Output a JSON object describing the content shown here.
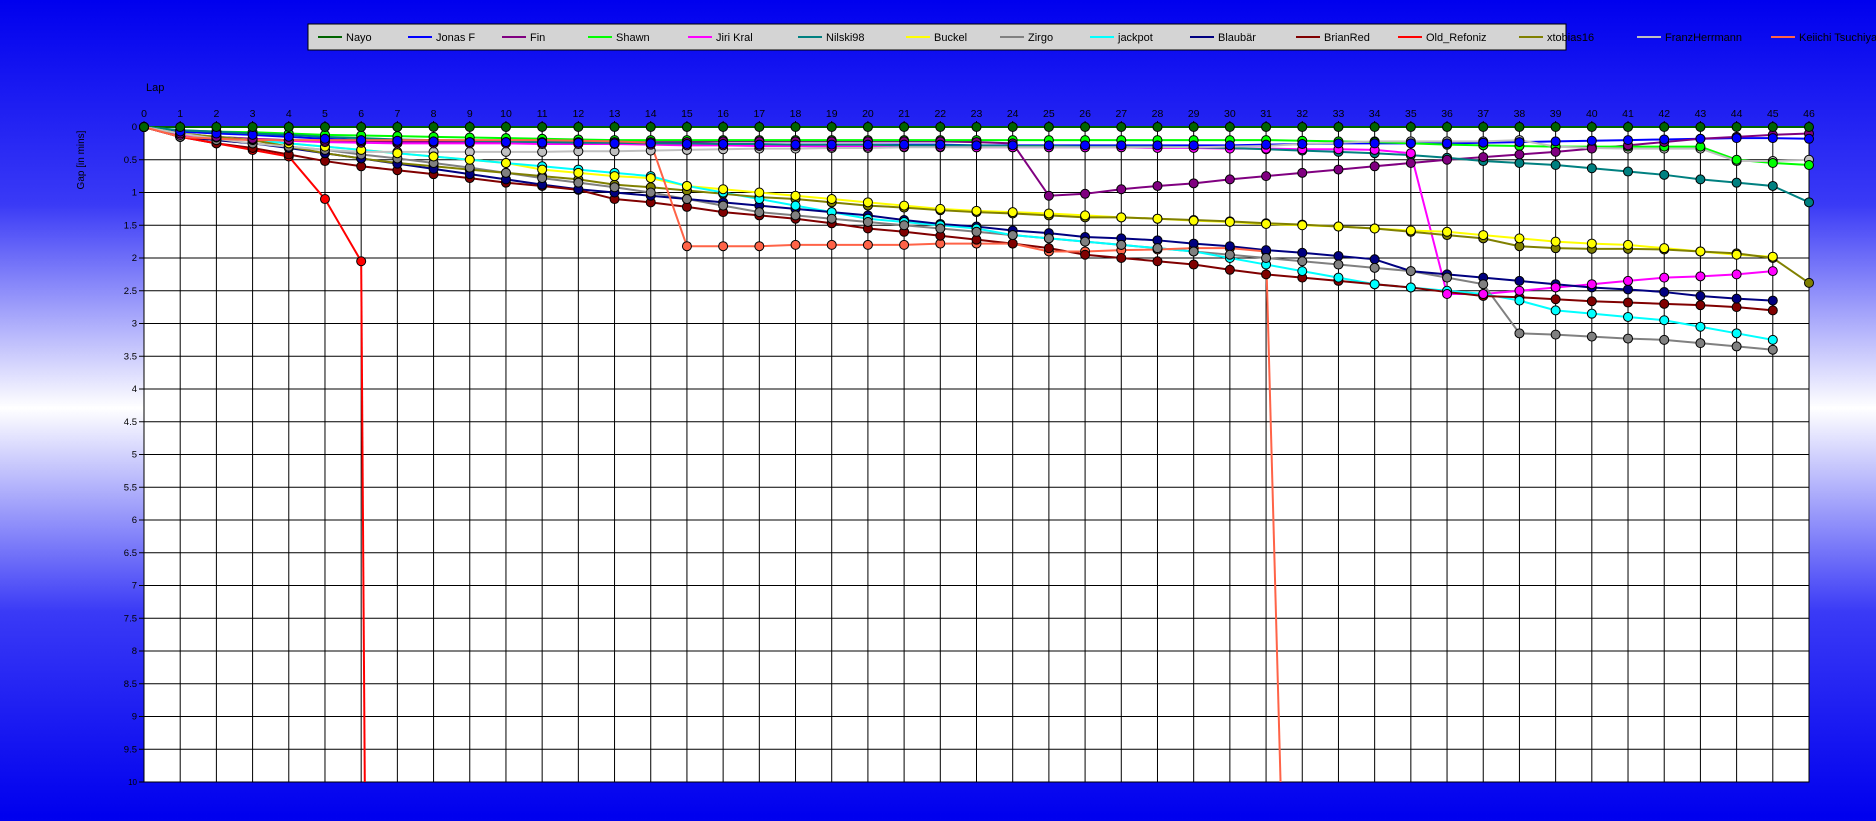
{
  "chart_data": {
    "type": "line",
    "xlabel": "Lap",
    "ylabel": "Gap [in mins]",
    "x": [
      0,
      1,
      2,
      3,
      4,
      5,
      6,
      7,
      8,
      9,
      10,
      11,
      12,
      13,
      14,
      15,
      16,
      17,
      18,
      19,
      20,
      21,
      22,
      23,
      24,
      25,
      26,
      27,
      28,
      29,
      30,
      31,
      32,
      33,
      34,
      35,
      36,
      37,
      38,
      39,
      40,
      41,
      42,
      43,
      44,
      45,
      46
    ],
    "xlim": [
      0,
      46
    ],
    "ylim": [
      0,
      10
    ],
    "y_inverted": true,
    "ytick_step": 0.5,
    "grid": true,
    "legend_position": "top-center",
    "series": [
      {
        "name": "Nayo",
        "color": "#006400",
        "values": [
          0,
          0,
          0,
          0,
          0,
          0,
          0,
          0,
          0,
          0,
          0,
          0,
          0,
          0,
          0,
          0,
          0,
          0,
          0,
          0,
          0,
          0,
          0,
          0,
          0,
          0,
          0,
          0,
          0,
          0,
          0,
          0,
          0,
          0,
          0,
          0,
          0,
          0,
          0,
          0,
          0,
          0,
          0,
          0,
          0,
          0,
          0
        ]
      },
      {
        "name": "Jonas F",
        "color": "#0000ff",
        "values": [
          0,
          0.07,
          0.1,
          0.12,
          0.15,
          0.18,
          0.2,
          0.21,
          0.22,
          0.23,
          0.23,
          0.24,
          0.24,
          0.25,
          0.25,
          0.26,
          0.26,
          0.27,
          0.27,
          0.27,
          0.27,
          0.27,
          0.27,
          0.28,
          0.28,
          0.28,
          0.28,
          0.28,
          0.28,
          0.28,
          0.28,
          0.27,
          0.26,
          0.25,
          0.25,
          0.25,
          0.25,
          0.24,
          0.23,
          0.22,
          0.21,
          0.2,
          0.19,
          0.18,
          0.17,
          0.17,
          0.18
        ]
      },
      {
        "name": "Fin",
        "color": "#800080",
        "values": [
          0,
          0.1,
          0.15,
          0.18,
          0.2,
          0.21,
          0.22,
          0.23,
          0.23,
          0.23,
          0.23,
          0.23,
          0.23,
          0.23,
          0.23,
          0.23,
          0.22,
          0.22,
          0.22,
          0.22,
          0.22,
          0.22,
          0.22,
          0.23,
          0.25,
          1.05,
          1.02,
          0.95,
          0.9,
          0.86,
          0.8,
          0.75,
          0.7,
          0.65,
          0.6,
          0.55,
          0.5,
          0.46,
          0.42,
          0.38,
          0.33,
          0.28,
          0.23,
          0.18,
          0.15,
          0.12,
          0.1
        ]
      },
      {
        "name": "Shawn",
        "color": "#00ff00",
        "values": [
          0,
          0.05,
          0.07,
          0.08,
          0.1,
          0.12,
          0.13,
          0.14,
          0.15,
          0.16,
          0.17,
          0.18,
          0.19,
          0.2,
          0.2,
          0.2,
          0.2,
          0.2,
          0.2,
          0.2,
          0.2,
          0.2,
          0.2,
          0.2,
          0.2,
          0.2,
          0.2,
          0.2,
          0.2,
          0.2,
          0.2,
          0.2,
          0.21,
          0.22,
          0.23,
          0.25,
          0.27,
          0.28,
          0.29,
          0.3,
          0.3,
          0.3,
          0.3,
          0.3,
          0.5,
          0.55,
          0.58
        ]
      },
      {
        "name": "Jiri Kral",
        "color": "#ff00ff",
        "values": [
          0,
          0.12,
          0.16,
          0.19,
          0.21,
          0.23,
          0.24,
          0.25,
          0.25,
          0.25,
          0.25,
          0.26,
          0.26,
          0.26,
          0.27,
          0.28,
          0.28,
          0.29,
          0.29,
          0.3,
          0.3,
          0.3,
          0.3,
          0.31,
          0.31,
          0.31,
          0.31,
          0.31,
          0.32,
          0.32,
          0.33,
          0.33,
          0.34,
          0.34,
          0.35,
          0.4,
          2.55,
          2.55,
          2.5,
          2.45,
          2.4,
          2.35,
          2.3,
          2.28,
          2.25,
          2.2,
          null
        ]
      },
      {
        "name": "Nilski98",
        "color": "#008080",
        "values": [
          0,
          0.05,
          0.07,
          0.1,
          0.12,
          0.15,
          0.17,
          0.19,
          0.2,
          0.21,
          0.22,
          0.23,
          0.24,
          0.24,
          0.25,
          0.25,
          0.26,
          0.26,
          0.27,
          0.27,
          0.27,
          0.28,
          0.28,
          0.28,
          0.29,
          0.29,
          0.3,
          0.3,
          0.3,
          0.31,
          0.32,
          0.34,
          0.36,
          0.38,
          0.4,
          0.43,
          0.47,
          0.52,
          0.55,
          0.58,
          0.63,
          0.68,
          0.73,
          0.8,
          0.85,
          0.9,
          1.15
        ]
      },
      {
        "name": "Buckel",
        "color": "#ffff00",
        "values": [
          0,
          0.1,
          0.15,
          0.2,
          0.25,
          0.3,
          0.35,
          0.4,
          0.45,
          0.5,
          0.55,
          0.65,
          0.7,
          0.75,
          0.78,
          0.9,
          0.95,
          1.0,
          1.05,
          1.1,
          1.15,
          1.2,
          1.25,
          1.28,
          1.3,
          1.32,
          1.35,
          1.38,
          1.4,
          1.43,
          1.45,
          1.48,
          1.5,
          1.52,
          1.55,
          1.58,
          1.6,
          1.65,
          1.7,
          1.75,
          1.78,
          1.8,
          1.85,
          1.9,
          1.95,
          1.98,
          null
        ]
      },
      {
        "name": "Zirgo",
        "color": "#808080",
        "values": [
          0,
          0.15,
          0.2,
          0.25,
          0.3,
          0.35,
          0.42,
          0.48,
          0.55,
          0.62,
          0.7,
          0.78,
          0.85,
          0.92,
          1.0,
          1.1,
          1.2,
          1.3,
          1.35,
          1.4,
          1.45,
          1.5,
          1.55,
          1.6,
          1.65,
          1.7,
          1.75,
          1.8,
          1.85,
          1.9,
          1.95,
          2.0,
          2.05,
          2.1,
          2.15,
          2.2,
          2.3,
          2.4,
          3.15,
          3.17,
          3.2,
          3.23,
          3.25,
          3.3,
          3.35,
          3.4,
          null
        ]
      },
      {
        "name": "jackpot",
        "color": "#00ffff",
        "values": [
          0,
          0.1,
          0.15,
          0.2,
          0.25,
          0.3,
          0.35,
          0.4,
          0.45,
          0.5,
          0.55,
          0.6,
          0.65,
          0.7,
          0.75,
          0.9,
          1.0,
          1.1,
          1.2,
          1.3,
          1.4,
          1.45,
          1.5,
          1.55,
          1.65,
          1.7,
          1.75,
          1.8,
          1.85,
          1.9,
          2.0,
          2.1,
          2.2,
          2.3,
          2.4,
          2.45,
          2.5,
          2.55,
          2.65,
          2.8,
          2.85,
          2.9,
          2.95,
          3.05,
          3.15,
          3.25,
          null
        ]
      },
      {
        "name": "Blaubär",
        "color": "#000080",
        "values": [
          0,
          0.15,
          0.2,
          0.25,
          0.32,
          0.4,
          0.48,
          0.56,
          0.64,
          0.72,
          0.8,
          0.88,
          0.95,
          1.0,
          1.05,
          1.1,
          1.15,
          1.2,
          1.25,
          1.3,
          1.35,
          1.42,
          1.48,
          1.52,
          1.58,
          1.62,
          1.68,
          1.7,
          1.73,
          1.78,
          1.82,
          1.88,
          1.92,
          1.97,
          2.02,
          2.2,
          2.25,
          2.3,
          2.35,
          2.4,
          2.45,
          2.48,
          2.52,
          2.58,
          2.62,
          2.65,
          null
        ]
      },
      {
        "name": "BrianRed",
        "color": "#800000",
        "values": [
          0,
          0.15,
          0.25,
          0.32,
          0.42,
          0.52,
          0.6,
          0.66,
          0.72,
          0.78,
          0.85,
          0.9,
          0.96,
          1.1,
          1.15,
          1.22,
          1.3,
          1.35,
          1.4,
          1.47,
          1.55,
          1.6,
          1.66,
          1.72,
          1.78,
          1.85,
          1.95,
          2.0,
          2.05,
          2.1,
          2.18,
          2.25,
          2.3,
          2.35,
          2.4,
          2.45,
          2.52,
          2.58,
          2.6,
          2.63,
          2.66,
          2.68,
          2.7,
          2.72,
          2.75,
          2.8,
          null
        ]
      },
      {
        "name": "Old_Refoniz",
        "color": "#ff0000",
        "values": [
          0,
          0.15,
          0.25,
          0.35,
          0.45,
          1.1,
          2.05,
          null,
          null,
          null,
          null,
          null,
          null,
          null,
          null,
          null,
          null,
          null,
          null,
          null,
          null,
          null,
          null,
          null,
          null,
          null,
          null,
          null,
          null,
          null,
          null,
          null,
          null,
          null,
          null,
          null,
          null,
          null,
          null,
          null,
          null,
          null,
          null,
          null,
          null,
          null,
          null
        ]
      },
      {
        "name": "xtobias16",
        "color": "#808000",
        "values": [
          0,
          0.1,
          0.15,
          0.2,
          0.3,
          0.4,
          0.48,
          0.55,
          0.6,
          0.65,
          0.7,
          0.75,
          0.8,
          0.88,
          0.92,
          0.97,
          1.02,
          1.07,
          1.1,
          1.15,
          1.2,
          1.23,
          1.27,
          1.3,
          1.32,
          1.35,
          1.38,
          1.38,
          1.4,
          1.42,
          1.44,
          1.47,
          1.49,
          1.52,
          1.55,
          1.6,
          1.65,
          1.7,
          1.82,
          1.85,
          1.86,
          1.86,
          1.87,
          1.9,
          1.93,
          2.0,
          2.38
        ]
      },
      {
        "name": "FranzHerrmann",
        "color": "#c0c0c0",
        "values": [
          0,
          0.1,
          0.18,
          0.25,
          0.3,
          0.35,
          0.38,
          0.38,
          0.38,
          0.38,
          0.38,
          0.38,
          0.37,
          0.37,
          0.36,
          0.35,
          0.34,
          0.33,
          0.33,
          0.32,
          0.32,
          0.31,
          0.31,
          0.31,
          0.31,
          0.31,
          0.31,
          0.31,
          0.31,
          0.31,
          0.3,
          0.29,
          0.26,
          0.24,
          0.22,
          0.22,
          0.22,
          0.22,
          0.2,
          0.3,
          0.32,
          0.33,
          0.33,
          0.33,
          0.52,
          0.52,
          0.5
        ]
      },
      {
        "name": "Keiichi Tsuchiya",
        "color": "#ff6347",
        "values": [
          0,
          0.15,
          0.18,
          0.2,
          0.2,
          0.2,
          0.2,
          0.2,
          0.2,
          0.2,
          0.2,
          0.2,
          0.21,
          0.22,
          0.24,
          1.82,
          1.82,
          1.82,
          1.8,
          1.8,
          1.8,
          1.8,
          1.78,
          1.78,
          1.78,
          1.9,
          1.9,
          1.88,
          1.87,
          1.85,
          1.85,
          1.9,
          null,
          null,
          null,
          null,
          null,
          null,
          null,
          null,
          null,
          null,
          null,
          null,
          null,
          null,
          null
        ]
      }
    ],
    "retired": [
      {
        "name": "Old_Refoniz",
        "last_x": 6,
        "to_x": 6.1
      },
      {
        "name": "Keiichi Tsuchiya",
        "last_x": 31,
        "to_x": 31.4
      }
    ]
  }
}
